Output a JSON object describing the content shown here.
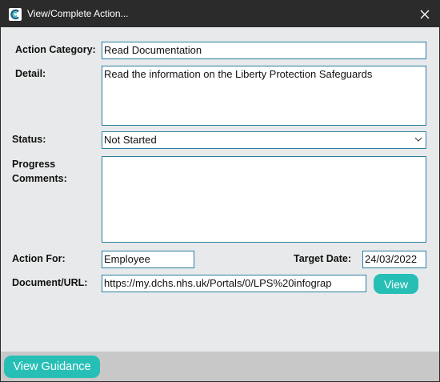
{
  "window": {
    "title": "View/Complete Action..."
  },
  "form": {
    "action_category": {
      "label": "Action Category:",
      "value": "Read Documentation"
    },
    "detail": {
      "label": "Detail:",
      "value": "Read the information on the Liberty Protection Safeguards"
    },
    "status": {
      "label": "Status:",
      "value": "Not Started"
    },
    "progress_comments": {
      "label_line1": "Progress",
      "label_line2": "Comments:",
      "value": ""
    },
    "action_for": {
      "label": "Action For:",
      "value": "Employee"
    },
    "target_date": {
      "label": "Target Date:",
      "value": "24/03/2022"
    },
    "document_url": {
      "label": "Document/URL:",
      "value": "https://my.dchs.nhs.uk/Portals/0/LPS%20infograp"
    },
    "view_button": {
      "label": "View"
    }
  },
  "footer": {
    "view_guidance_label": "View Guidance"
  },
  "colors": {
    "accent": "#27bfb5",
    "field_border": "#2a7fa0",
    "titlebar": "#2b2b2b",
    "body": "#e8e9ea",
    "footer": "#c8c8c8"
  }
}
